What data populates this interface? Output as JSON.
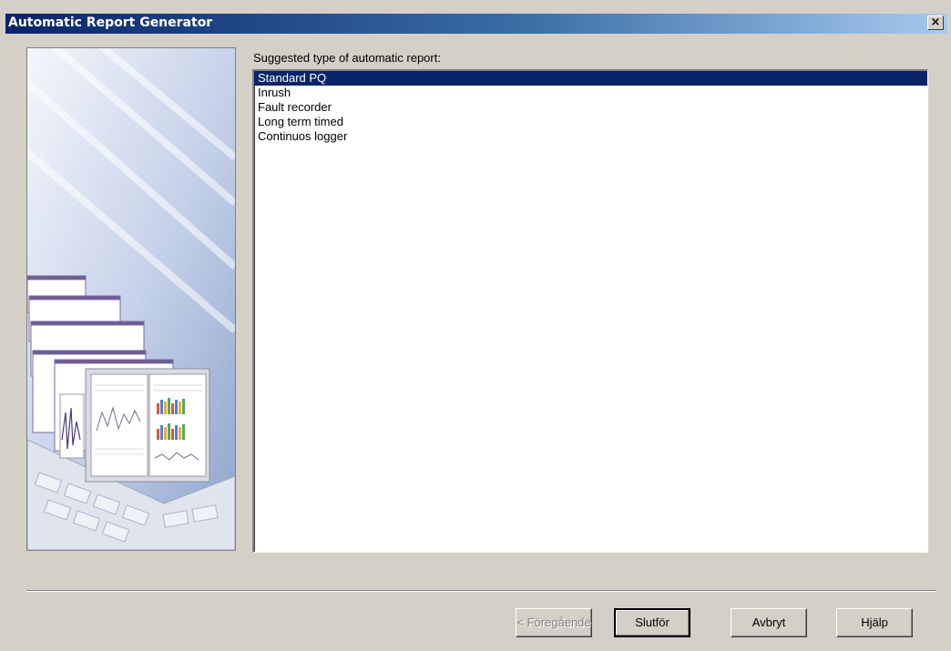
{
  "window": {
    "title": "Automatic Report Generator",
    "close_label": "×"
  },
  "main": {
    "prompt": "Suggested type of automatic report:",
    "report_types": [
      {
        "label": "Standard PQ",
        "selected": true
      },
      {
        "label": "Inrush",
        "selected": false
      },
      {
        "label": "Fault recorder",
        "selected": false
      },
      {
        "label": "Long term timed",
        "selected": false
      },
      {
        "label": "Continuos logger",
        "selected": false
      }
    ]
  },
  "buttons": {
    "previous": "< Föregående",
    "finish": "Slutför",
    "cancel": "Avbryt",
    "help": "Hjälp"
  },
  "colors": {
    "selection": "#0a246a",
    "titlebar_start": "#0a246a",
    "titlebar_end": "#a6caf0",
    "dialog_bg": "#d4d0c8"
  }
}
